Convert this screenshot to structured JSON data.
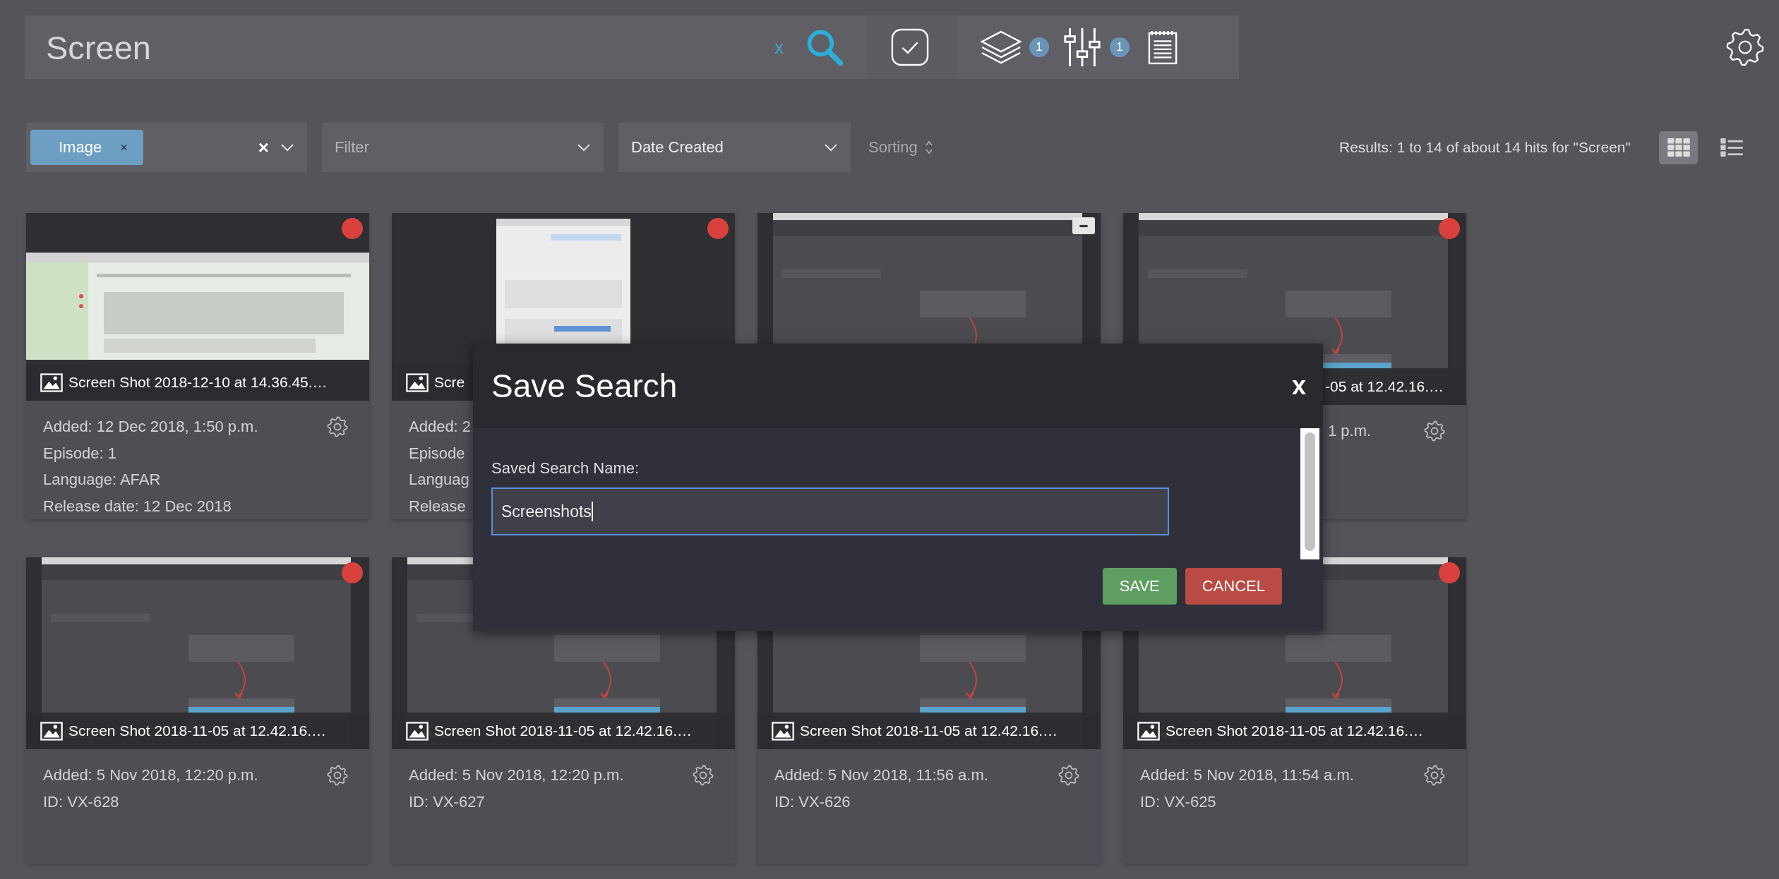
{
  "search": {
    "value": "Screen",
    "clear": "x",
    "badges": [
      "1",
      "1"
    ]
  },
  "filters": {
    "tag": "Image",
    "tag_remove": "×",
    "clear": "×",
    "filter_placeholder": "Filter",
    "sort_field": "Date Created",
    "sorting": "Sorting"
  },
  "results": "Results: 1 to 14 of about 14 hits for \"Screen\"",
  "view_modes": [
    {
      "kind": "grid",
      "selected": true
    },
    {
      "kind": "list",
      "selected": false
    }
  ],
  "cards": [
    {
      "title": "Screen Shot 2018-12-10 at 14.36.45.…",
      "kind": "flagged",
      "lines": [
        "Added: 12 Dec 2018, 1:50 p.m.",
        "Episode: 1",
        "Language: AFAR",
        "Release date: 12 Dec 2018"
      ]
    },
    {
      "title": "Scre",
      "kind": "flagged",
      "lines": [
        "Added: 2",
        "Episode",
        "Languag",
        "Release"
      ]
    },
    {
      "kind": "collapsible"
    },
    {
      "title": "-05 at 12.42.16.…",
      "kind": "flagged",
      "lines": [
        "1 p.m."
      ]
    },
    {
      "title": "Screen Shot 2018-11-05 at 12.42.16.…",
      "kind": "flagged",
      "lines": [
        "Added: 5 Nov 2018, 12:20 p.m.",
        "ID: VX-628"
      ]
    },
    {
      "title": "Screen Shot 2018-11-05 at 12.42.16.…",
      "lines": [
        "Added: 5 Nov 2018, 12:20 p.m.",
        "ID: VX-627"
      ]
    },
    {
      "title": "Screen Shot 2018-11-05 at 12.42.16.…",
      "lines": [
        "Added: 5 Nov 2018, 11:56 a.m.",
        "ID: VX-626"
      ]
    },
    {
      "title": "Screen Shot 2018-11-05 at 12.42.16.…",
      "kind": "flagged",
      "lines": [
        "Added: 5 Nov 2018, 11:54 a.m.",
        "ID: VX-625"
      ]
    }
  ],
  "dialog": {
    "title": "Save Search",
    "close": "x",
    "label": "Saved Search Name:",
    "value": "Screenshots",
    "buttons": [
      {
        "label": "SAVE",
        "kind": "primary"
      },
      {
        "label": "CANCEL",
        "kind": "danger"
      }
    ]
  }
}
